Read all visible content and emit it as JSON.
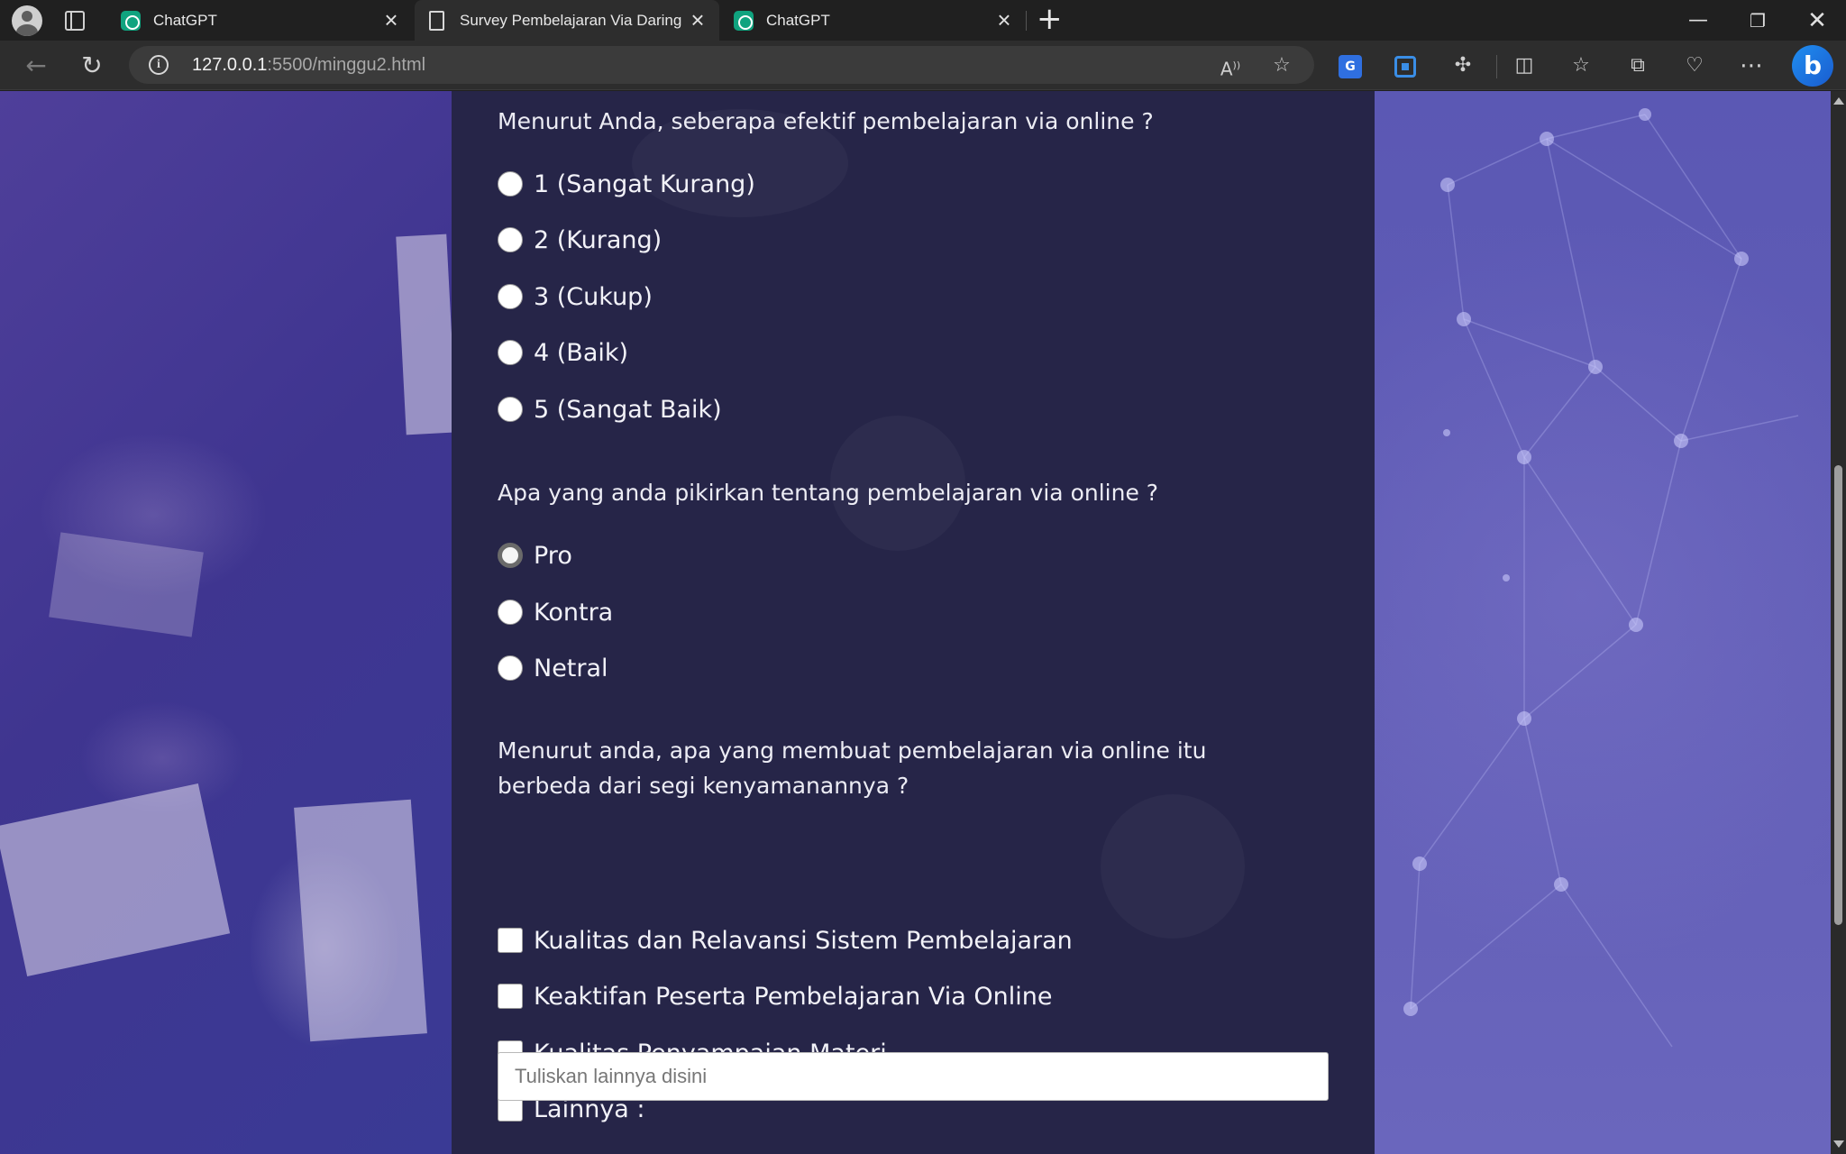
{
  "browser": {
    "tabs": [
      {
        "title": "ChatGPT",
        "icon": "chatgpt-icon"
      },
      {
        "title": "Survey Pembelajaran Via Daring",
        "icon": "document-icon",
        "active": true
      },
      {
        "title": "ChatGPT",
        "icon": "chatgpt-icon"
      }
    ],
    "url_host": "127.0.0.1",
    "url_rest": ":5500/minggu2.html"
  },
  "survey": {
    "q1": {
      "text": "Menurut Anda, seberapa efektif pembelajaran via online ?",
      "options": [
        "1 (Sangat Kurang)",
        "2 (Kurang)",
        "3 (Cukup)",
        "4 (Baik)",
        "5 (Sangat Baik)"
      ]
    },
    "q2": {
      "text": "Apa yang anda pikirkan tentang pembelajaran via online ?",
      "options": [
        "Pro",
        "Kontra",
        "Netral"
      ],
      "selected": "Pro"
    },
    "q3": {
      "text_line1": "Menurut anda, apa yang membuat pembelajaran via online itu",
      "text_line2": "berbeda dari segi kenyamanannya ?",
      "options": [
        "Kualitas dan Relavansi Sistem Pembelajaran",
        "Keaktifan Peserta Pembelajaran Via Online",
        "Kualitas Penyampaian Materi",
        "Lainnya :"
      ],
      "other_placeholder": "Tuliskan lainnya disini"
    }
  }
}
